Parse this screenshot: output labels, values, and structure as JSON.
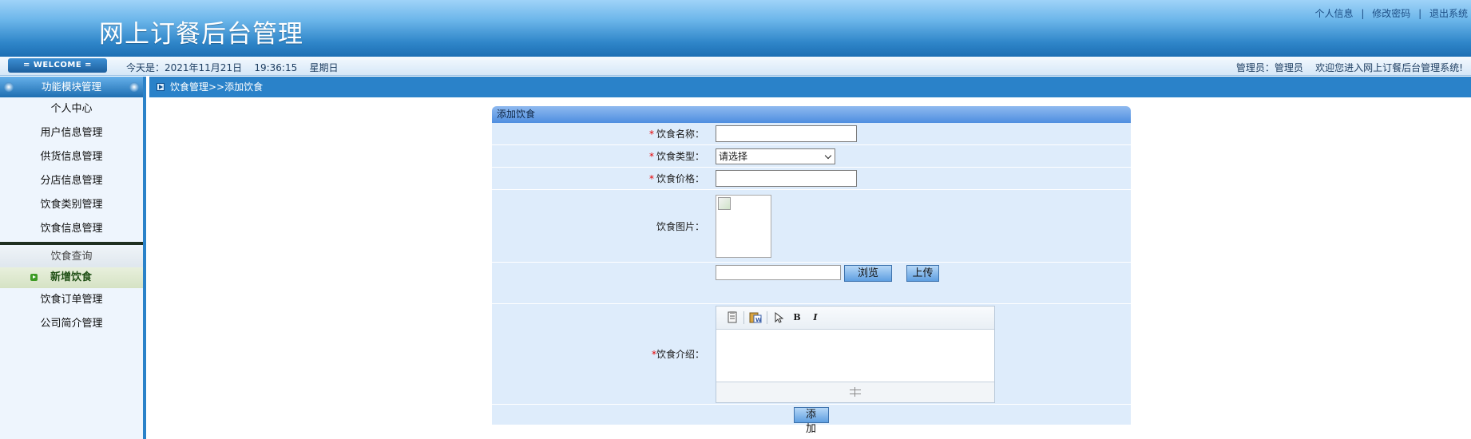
{
  "app": {
    "title": "网上订餐后台管理"
  },
  "top_links": {
    "profile": "个人信息",
    "change_password": "修改密码",
    "logout": "退出系统",
    "separator": "|"
  },
  "infobar": {
    "welcome": "= WELCOME =",
    "date_text": "今天是：2021年11月21日    19:36:15    星期日",
    "admin_text": "管理员：管理员    欢迎您进入网上订餐后台管理系统!"
  },
  "sidebar": {
    "title": "功能模块管理",
    "items": [
      {
        "label": "个人中心"
      },
      {
        "label": "用户信息管理"
      },
      {
        "label": "供货信息管理"
      },
      {
        "label": "分店信息管理"
      },
      {
        "label": "饮食类别管理"
      },
      {
        "label": "饮食信息管理"
      }
    ],
    "submenu": {
      "title": "饮食查询",
      "active_item": "新增饮食"
    },
    "items_after": [
      {
        "label": "饮食订单管理"
      },
      {
        "label": "公司简介管理"
      }
    ]
  },
  "breadcrumb": {
    "text": "饮食管理>>添加饮食"
  },
  "form": {
    "title": "添加饮食",
    "required_mark": "*",
    "fields": {
      "name": {
        "label": "饮食名称：",
        "value": ""
      },
      "type": {
        "label": "饮食类型：",
        "selected": "请选择"
      },
      "price": {
        "label": "饮食价格：",
        "value": ""
      },
      "image": {
        "label": "饮食图片："
      },
      "intro": {
        "label": "饮食介绍："
      }
    },
    "upload": {
      "browse_label": "浏览",
      "upload_label": "上传"
    },
    "editor_tools": [
      "paste-text-icon",
      "paste-word-icon",
      "select-cursor-icon",
      "bold-icon",
      "italic-icon"
    ],
    "submit_label": "添 加"
  },
  "colors": {
    "header_blue": "#2f86c9",
    "nav_blue": "#2a82c9",
    "form_row_bg": "#deecfb",
    "required_red": "#e60000",
    "active_green": "#3c9a24"
  }
}
